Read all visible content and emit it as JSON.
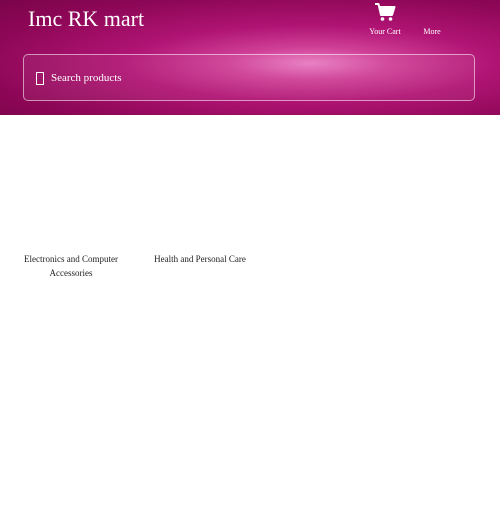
{
  "header": {
    "brand": "Imc RK mart",
    "nav": {
      "cart_label": "Your Cart",
      "more_label": "More"
    },
    "search": {
      "placeholder": "Search products"
    }
  },
  "categories": [
    {
      "name": "Electronics and Computer Accessories"
    },
    {
      "name": "Health and Personal Care"
    }
  ],
  "colors": {
    "header_gradient": [
      "#e87ac0",
      "#b01474",
      "#7a044a"
    ],
    "text_light": "#ffffff",
    "text_dark": "#222222"
  },
  "icons": {
    "cart": "shopping-cart-icon",
    "search": "search-icon"
  }
}
